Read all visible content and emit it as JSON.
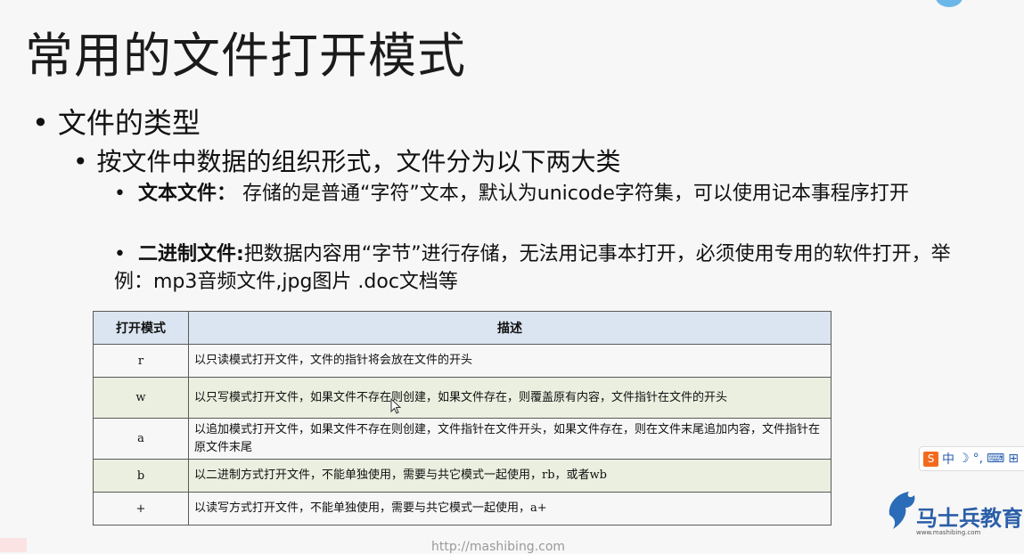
{
  "title": "常用的文件打开模式",
  "bullets": {
    "level1": "文件的类型",
    "level2": "按文件中数据的组织形式，文件分为以下两大类",
    "text_file_label": "文本文件：",
    "text_file_desc": "存储的是普通“字符”文本，默认为unicode字符集，可以使用记本事程序打开",
    "binary_file_label": "二进制文件:",
    "binary_file_desc": "把数据内容用“字节”进行存储，无法用记事本打开，必须使用专用的软件打开，举例：mp3音频文件,jpg图片 .doc文档等"
  },
  "table": {
    "headers": [
      "打开模式",
      "描述"
    ],
    "rows": [
      {
        "mode": "r",
        "desc": "以只读模式打开文件，文件的指针将会放在文件的开头"
      },
      {
        "mode": "w",
        "desc": "以只写模式打开文件，如果文件不存在则创建，如果文件存在，则覆盖原有内容，文件指针在文件的开头"
      },
      {
        "mode": "a",
        "desc": "以追加模式打开文件，如果文件不存在则创建，文件指针在文件开头，如果文件存在，则在文件末尾追加内容，文件指针在原文件末尾"
      },
      {
        "mode": "b",
        "desc": "以二进制方式打开文件，不能单独使用，需要与共它模式一起使用，rb，或者wb"
      },
      {
        "mode": "+",
        "desc": "以读写方式打开文件，不能单独使用，需要与共它模式一起使用，a+"
      }
    ]
  },
  "ime": {
    "mode": "中",
    "logo": "S"
  },
  "brand": {
    "name": "马士兵教育",
    "url": "www.mashibing.com"
  },
  "footer_url": "http://mashibing.com"
}
